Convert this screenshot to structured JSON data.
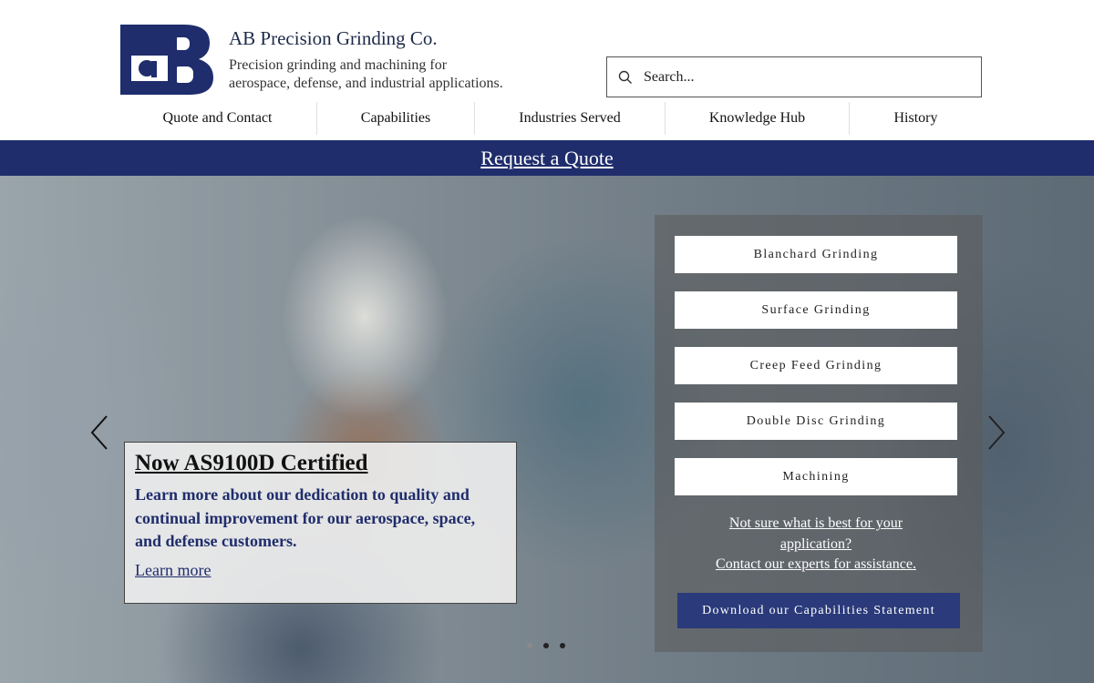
{
  "header": {
    "company_name": "AB Precision Grinding Co.",
    "tagline_line1": "Precision grinding and machining for",
    "tagline_line2": "aerospace, defense, and industrial applications.",
    "logo_icon": "ab-monogram-logo",
    "brand_color": "#1f2d6c"
  },
  "search": {
    "placeholder": "Search...",
    "icon": "search-icon"
  },
  "nav": {
    "items": [
      {
        "label": "Quote and Contact"
      },
      {
        "label": "Capabilities"
      },
      {
        "label": "Industries Served"
      },
      {
        "label": "Knowledge Hub"
      },
      {
        "label": "History"
      }
    ]
  },
  "banner": {
    "label": "Request a Quote"
  },
  "hero": {
    "slide": {
      "title": "Now AS9100D Certified ",
      "description": "Learn more about our dedication to quality and continual improvement for our aerospace, space, and defense customers.",
      "link_label": "Learn more "
    },
    "slides_total": 3,
    "active_slide": 2,
    "prev_icon": "chevron-left-icon",
    "next_icon": "chevron-right-icon"
  },
  "capabilities": {
    "buttons": [
      {
        "label": "Blanchard Grinding"
      },
      {
        "label": "Surface Grinding"
      },
      {
        "label": "Creep Feed Grinding"
      },
      {
        "label": "Double Disc Grinding"
      },
      {
        "label": "Machining"
      }
    ],
    "help_line1": "Not sure what is best for your application?",
    "help_line2": "Contact our experts for assistance.",
    "download_label": "Download our Capabilities Statement"
  }
}
